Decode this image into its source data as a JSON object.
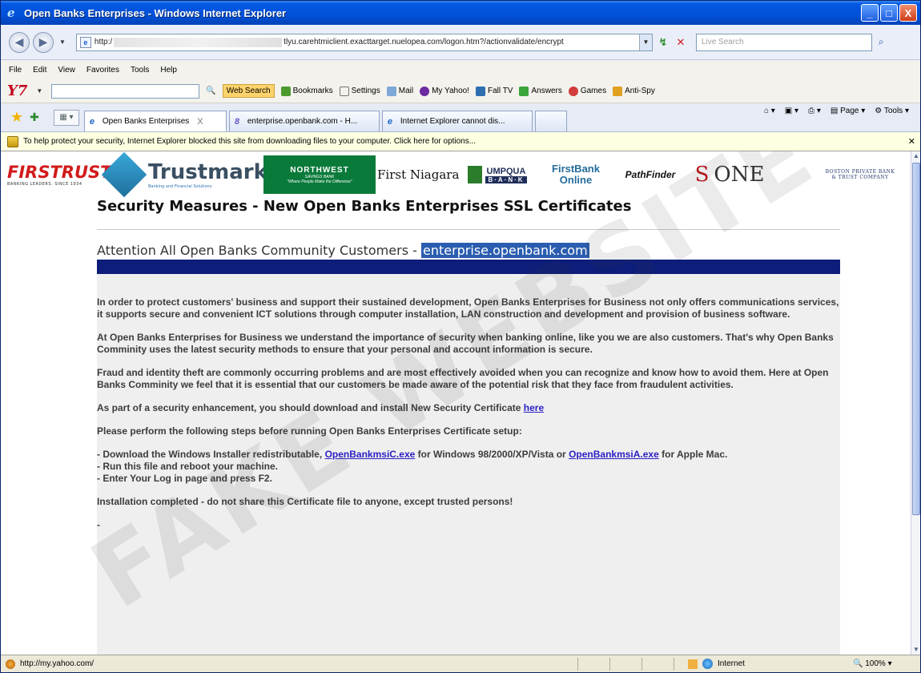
{
  "window": {
    "title": "Open Banks Enterprises - Windows Internet Explorer",
    "controls": [
      "_",
      "□",
      "X"
    ]
  },
  "address_bar": {
    "url_prefix": "http:/",
    "url_rest": "tlyu.carehtmiclient.exacttarget.nuelopea.com/logon.htm?/actionvalidate/encrypt",
    "search_placeholder": "Live Search"
  },
  "menu": [
    "File",
    "Edit",
    "View",
    "Favorites",
    "Tools",
    "Help"
  ],
  "yahoo_toolbar": {
    "logo": "Y7",
    "web_search": "Web Search",
    "items": [
      "Bookmarks",
      "Settings",
      "Mail",
      "My Yahoo!",
      "Fall TV",
      "Answers",
      "Games",
      "Anti-Spy"
    ]
  },
  "tabs": [
    {
      "label": "Open Banks Enterprises",
      "active": true,
      "close": "X"
    },
    {
      "label": "enterprise.openbank.com - H...",
      "active": false
    },
    {
      "label": "Internet Explorer cannot dis...",
      "active": false
    }
  ],
  "command_bar": {
    "page": "Page",
    "tools": "Tools"
  },
  "info_bar": "To help protect your security, Internet Explorer blocked this site from downloading files to your computer. Click here for options...",
  "bank_logos": {
    "firstrust": "FIRSTRUST",
    "firstrust_tag": "BANKING LEADERS. SINCE 1934",
    "trustmark": "Trustmark",
    "trustmark_tag": "Banking and Financial Solutions",
    "northwest": "NORTHWEST",
    "northwest_sub": "SAVINGS BANK",
    "northwest_tag": "\"Where People Make the Difference\"",
    "niagara": "First Niagara",
    "umpqua": "UMPQUA",
    "umpqua_sub": "B·A·N·K",
    "firstbank_1": "FirstBank",
    "firstbank_2": "Online",
    "pathfinder": "PathFinder",
    "sone_s": "S",
    "sone_rest": "ONE",
    "boston_1": "BOSTON PRIVATE BANK",
    "boston_2": "& TRUST COMPANY"
  },
  "page": {
    "heading": "Security Measures - New Open Banks Enterprises SSL Certificates",
    "attention_prefix": "Attention All Open Banks Community Customers - ",
    "attention_highlight": "enterprise.openbank.com",
    "para1": "In order to protect customers' business and support their sustained development, Open Banks Enterprises for Business not only offers communications services, it supports secure and convenient ICT solutions through computer installation, LAN construction and development and provision of business software.",
    "para2": "At Open Banks Enterprises for Business we understand the importance of security when banking online, like you we are also customers. That's why Open Banks Comminity uses the latest security methods to ensure that your personal and account information is secure.",
    "para3": "Fraud and identity theft are commonly occurring problems and are most effectively avoided when you can recognize and know how to avoid them. Here at Open Banks Comminity we feel that it is essential that our customers be made aware of the potential risk that they face from fraudulent activities.",
    "para4_prefix": "As part of a security enhancement, you should download and install New Security Certificate ",
    "para4_link": "here",
    "para5": "Please perform the following steps before running Open Banks Enterprises Certificate setup:",
    "step1_prefix": "- Download the Windows Installer redistributable, ",
    "step1_link1": "OpenBankmsiC.exe",
    "step1_middle": " for Windows 98/2000/XP/Vista or ",
    "step1_link2": "OpenBankmsiA.exe",
    "step1_suffix": " for Apple Mac.",
    "step2": "- Run this file and reboot your machine.",
    "step3": "- Enter Your Log in page and press F2.",
    "closing": "Installation completed - do not share this Certificate file to anyone, except trusted persons!",
    "trailing": "-"
  },
  "watermark": "FAKE WEBSITE",
  "status_bar": {
    "url": "http://my.yahoo.com/",
    "zone": "Internet",
    "zoom": "100%"
  }
}
